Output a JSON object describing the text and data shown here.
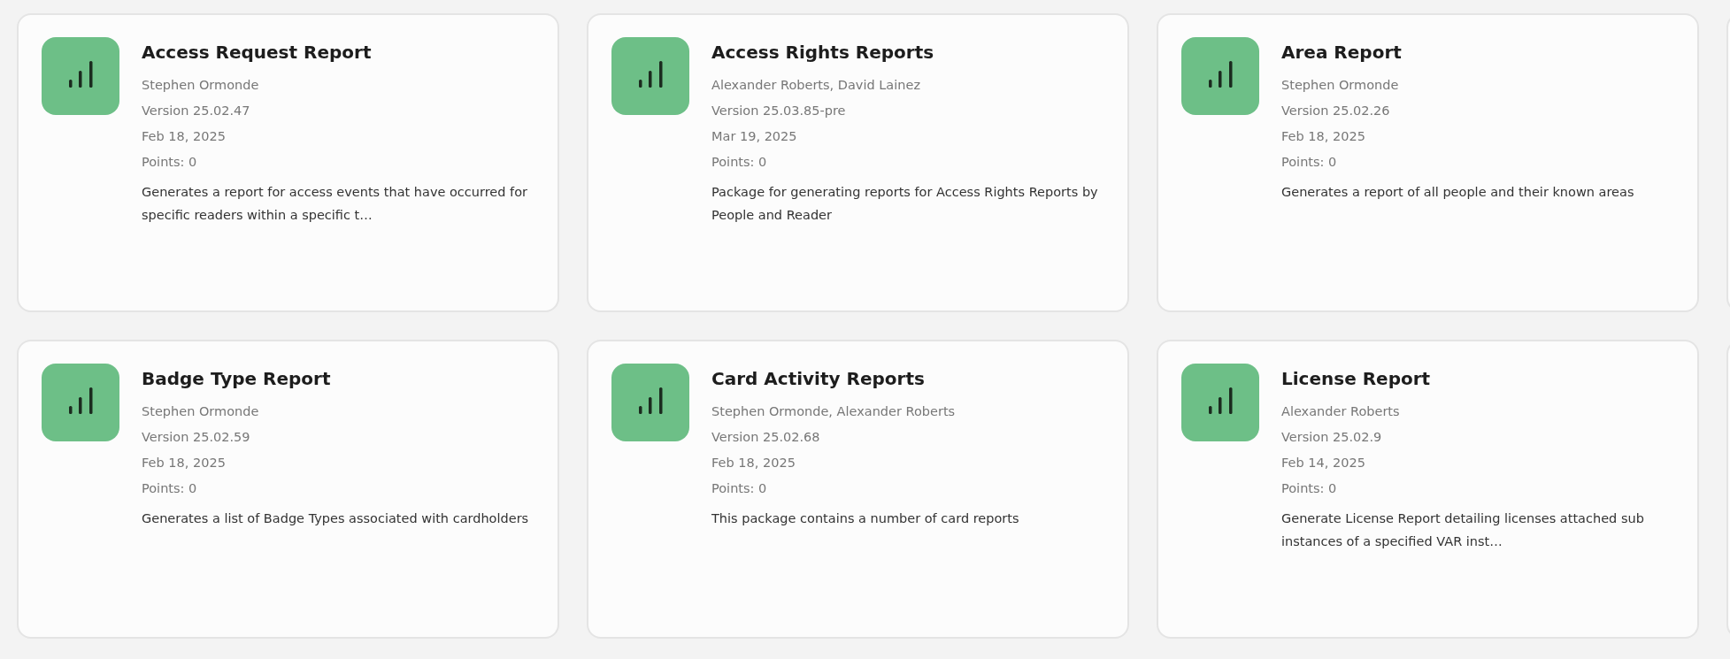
{
  "packages": [
    {
      "title": "Access Request Report",
      "authors": "Stephen Ormonde",
      "version": "Version 25.02.47",
      "date": "Feb 18, 2025",
      "points": "Points: 0",
      "description": "Generates a report for access events that have occurred for specific readers within a specific t…"
    },
    {
      "title": "Access Rights Reports",
      "authors": "Alexander Roberts, David Lainez",
      "version": "Version 25.03.85-pre",
      "date": "Mar 19, 2025",
      "points": "Points: 0",
      "description": "Package for generating reports for Access Rights Reports by People and Reader"
    },
    {
      "title": "Area Report",
      "authors": "Stephen Ormonde",
      "version": "Version 25.02.26",
      "date": "Feb 18, 2025",
      "points": "Points: 0",
      "description": "Generates a report of all people and their known areas"
    },
    {
      "title": "Badge Type Report",
      "authors": "Stephen Ormonde",
      "version": "Version 25.02.59",
      "date": "Feb 18, 2025",
      "points": "Points: 0",
      "description": "Generates a list of Badge Types associated with cardholders"
    },
    {
      "title": "Card Activity Reports",
      "authors": "Stephen Ormonde, Alexander Roberts",
      "version": "Version 25.02.68",
      "date": "Feb 18, 2025",
      "points": "Points: 0",
      "description": "This package contains a number of card reports"
    },
    {
      "title": "License Report",
      "authors": "Alexander Roberts",
      "version": "Version 25.02.9",
      "date": "Feb 14, 2025",
      "points": "Points: 0",
      "description": "Generate License Report detailing licenses attached sub instances of a specified VAR inst…"
    }
  ]
}
